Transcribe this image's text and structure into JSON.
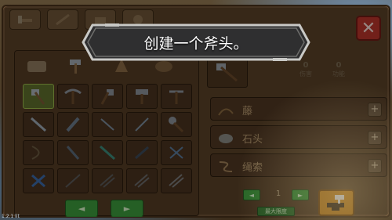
{
  "tutorial": {
    "message": "创建一个斧头。"
  },
  "close_label": "✕",
  "pager": {
    "prev_label": "◄",
    "next_label": "►"
  },
  "requirements": [
    {
      "name": "藤",
      "icon": "vine-icon"
    },
    {
      "name": "石头",
      "icon": "stone-icon"
    },
    {
      "name": "绳索",
      "icon": "rope-icon"
    }
  ],
  "plus_label": "+",
  "stats": [
    {
      "value": "0",
      "label": "伤害"
    },
    {
      "value": "0",
      "label": "功能"
    }
  ],
  "quantity": {
    "prev_label": "◄",
    "next_label": "►",
    "value": "1",
    "max_label": "最大限度"
  },
  "corner_label": "1.2.1 lit",
  "colors": {
    "accent_green": "#3ea33e",
    "close_red": "#b8342a",
    "craft_orange": "#d08a1c"
  }
}
